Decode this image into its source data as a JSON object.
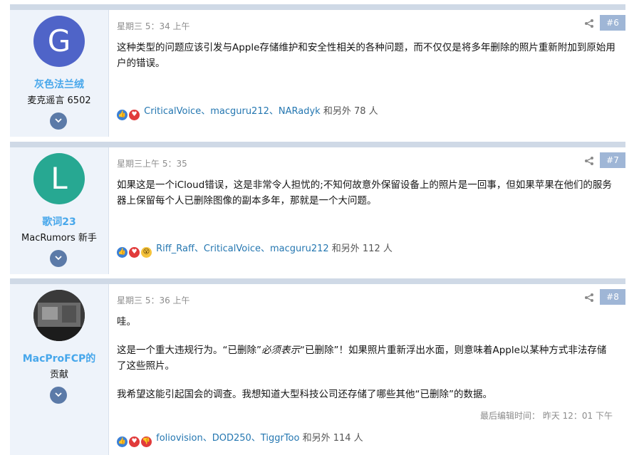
{
  "posts": [
    {
      "username": "灰色法兰绒",
      "user_title": "麦克遥言 6502",
      "avatar_letter": "G",
      "avatar_color": "#4f64c8",
      "date": "星期三 5：34 上午",
      "post_number": "#6",
      "body": [
        "这种类型的问题应该引发与Apple存储维护和安全性相关的各种问题，而不仅仅是将多年删除的照片重新附加到原始用户的错误。"
      ],
      "reactions": {
        "names": "CriticalVoice、macguru212、NARadyk",
        "suffix": "和另外 78 人"
      }
    },
    {
      "username": "歌词23",
      "user_title": "MacRumors 新手",
      "avatar_letter": "L",
      "avatar_color": "#27a892",
      "date": "星期三上午 5：35",
      "post_number": "#7",
      "body": [
        "如果这是一个iCloud错误，这是非常令人担忧的;不知何故意外保留设备上的照片是一回事，但如果苹果在他们的服务器上保留每个人已删除图像的副本多年，那就是一个大问题。"
      ],
      "reactions": {
        "names": "Riff_Raff、CriticalVoice、macguru212",
        "suffix": "和另外 112 人"
      }
    },
    {
      "username": "MacProFCP的",
      "user_title": "贡献",
      "date": "星期三 5：36 上午",
      "post_number": "#8",
      "body": [
        "哇。",
        "这是一个重大违规行为。“已删除”必须表示“已删除”！如果照片重新浮出水面，则意味着Apple以某种方式非法存储了这些照片。",
        "我希望这能引起国会的调查。我想知道大型科技公司还存储了哪些其他“已删除”的数据。"
      ],
      "body_emphasis": "必须表示",
      "edited": "最后编辑时间：  昨天 12：01 下午",
      "reactions": {
        "names": "foliovision、DOD250、TiggrToo",
        "suffix": "和另外 114 人"
      }
    }
  ]
}
